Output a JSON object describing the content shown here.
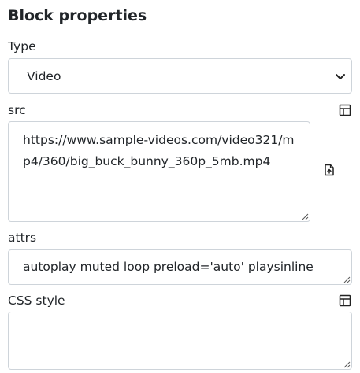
{
  "panel": {
    "title": "Block properties"
  },
  "type_field": {
    "label": "Type",
    "value": "Video",
    "options": [
      "Video"
    ]
  },
  "src_field": {
    "label": "src",
    "value": "https://www.sample-videos.com/video321/mp4/360/big_buck_bunny_360p_5mb.mp4",
    "icons": {
      "expand": "layout-panel-icon",
      "upload": "file-upload-icon"
    }
  },
  "attrs_field": {
    "label": "attrs",
    "value": "autoplay muted loop preload='auto' playsinline"
  },
  "css_field": {
    "label": "CSS style",
    "value": "",
    "icons": {
      "expand": "layout-panel-icon"
    }
  }
}
